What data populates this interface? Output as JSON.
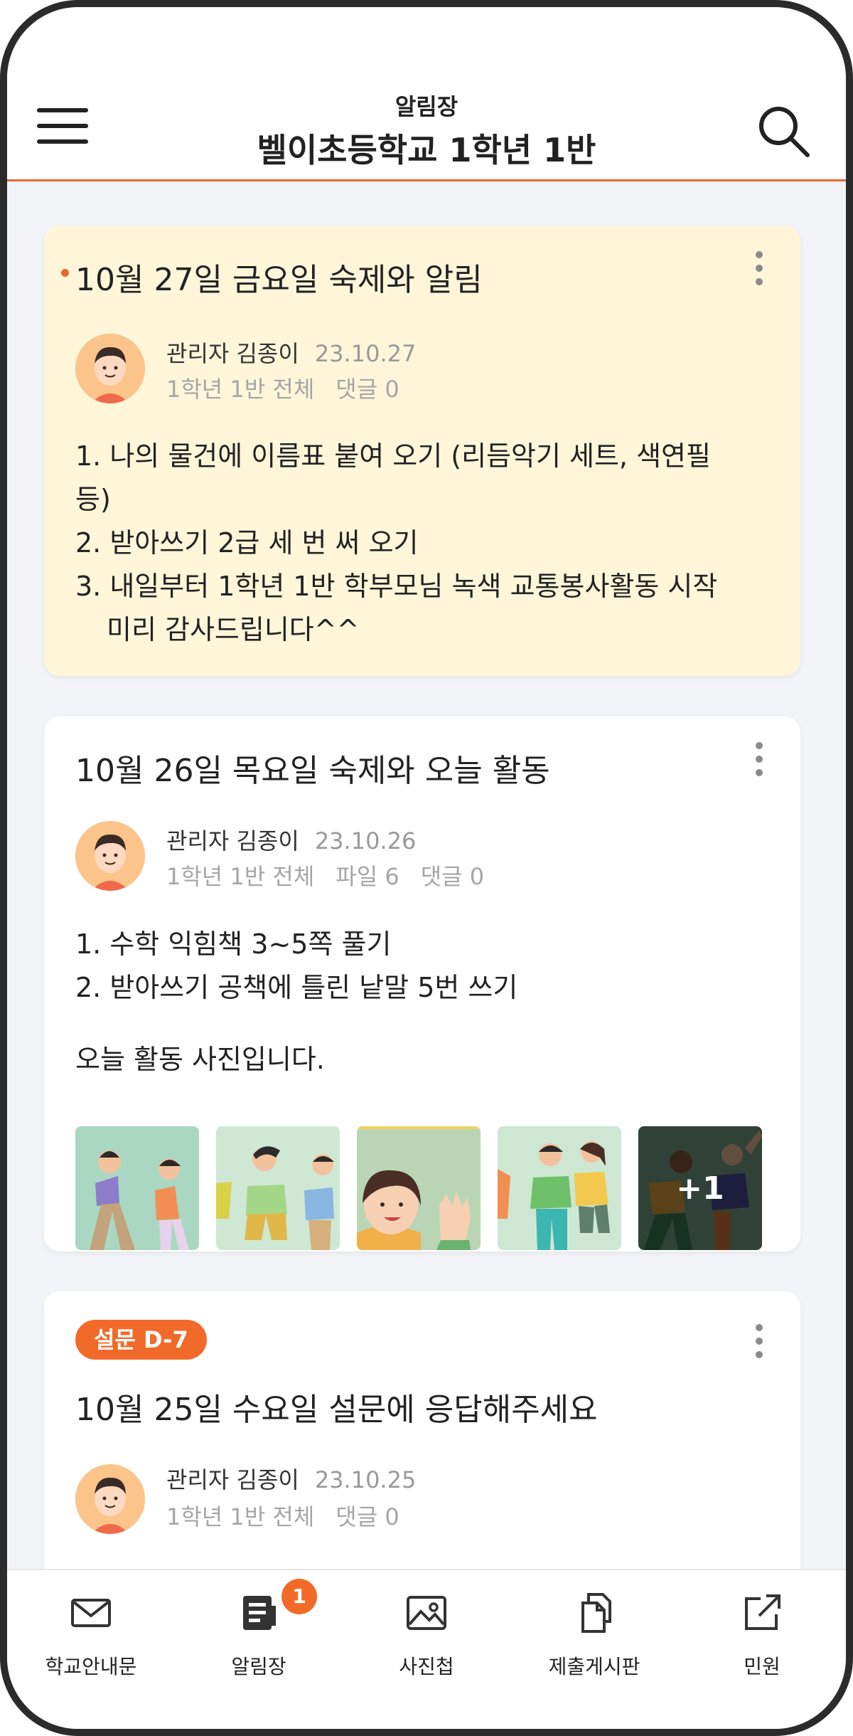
{
  "header": {
    "subtitle": "알림장",
    "title": "벨이초등학교 1학년 1반"
  },
  "posts": [
    {
      "title": "10월 27일 금요일 숙제와 알림",
      "author": "관리자 김종이",
      "date": "23.10.27",
      "audience": "1학년 1반 전체",
      "comments": "댓글 0",
      "lines": [
        "1. 나의 물건에 이름표 붙여 오기 (리듬악기 세트, 색연필",
        "등)",
        "2. 받아쓰기 2급 세 번 써 오기",
        "3. 내일부터 1학년 1반 학부모님 녹색 교통봉사활동 시작",
        "미리 감사드립니다^^"
      ]
    },
    {
      "title": "10월 26일 목요일 숙제와 오늘 활동",
      "author": "관리자 김종이",
      "date": "23.10.26",
      "audience": "1학년 1반 전체",
      "files": "파일 6",
      "comments": "댓글 0",
      "lines": [
        "1. 수학 익힘책 3~5쪽 풀기",
        "2. 받아쓰기 공책에 틀린 낱말 5번 쓰기"
      ],
      "note": "오늘 활동 사진입니다.",
      "more_photos": "+1"
    },
    {
      "badge": "설문 D-7",
      "title": "10월 25일 수요일 설문에 응답해주세요",
      "author": "관리자 김종이",
      "date": "23.10.25",
      "audience": "1학년 1반 전체",
      "comments": "댓글 0"
    }
  ],
  "tabs": [
    {
      "label": "학교안내문",
      "icon": "mail-icon"
    },
    {
      "label": "알림장",
      "icon": "notebook-icon",
      "badge": "1"
    },
    {
      "label": "사진첩",
      "icon": "image-icon"
    },
    {
      "label": "제출게시판",
      "icon": "documents-icon"
    },
    {
      "label": "민원",
      "icon": "external-link-icon"
    }
  ],
  "colors": {
    "accent": "#f26a2a",
    "pinned_background": "#fff6d9",
    "page_background": "#f2f4f8"
  }
}
